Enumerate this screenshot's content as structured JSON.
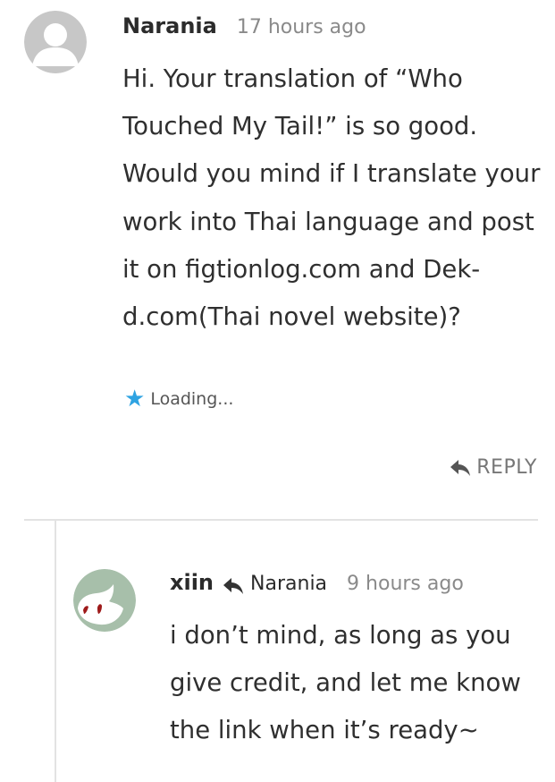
{
  "comment": {
    "author": "Narania",
    "time": "17 hours ago",
    "text": "Hi. Your translation of “Who Touched My Tail!” is so good. Would you mind if I translate your work into Thai language and post it on figtionlog.com and Dek-d.com(Thai novel website)?",
    "avatar_icon": "default-user-avatar",
    "likes": {
      "icon": "star-icon",
      "label": "Loading..."
    },
    "reply_button": {
      "icon": "reply-arrow-icon",
      "label": "REPLY"
    }
  },
  "reply": {
    "author": "xiin",
    "reply_icon": "reply-arrow-icon",
    "in_reply_to": "Narania",
    "time": "9 hours ago",
    "text": "i don’t mind, as long as you give credit, and let me know the link when it’s ready~",
    "avatar_icon": "character-avatar"
  },
  "colors": {
    "star": "#2ea3e2",
    "meta_gray": "#8a8a8a",
    "divider": "#e3e3e3",
    "avatar_default": "#c7c7c7",
    "avatar_xiin": "#a7bfaa"
  }
}
